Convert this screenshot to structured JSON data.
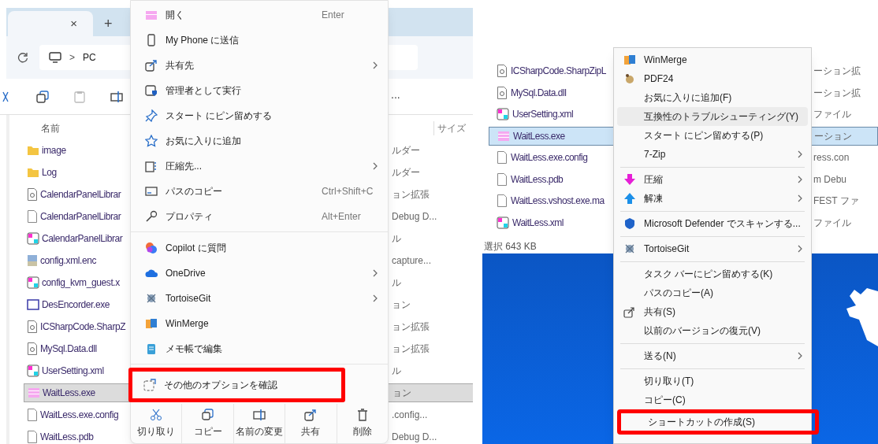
{
  "left_screen": {
    "tab_bar": {
      "close_glyph": "×",
      "new_tab_glyph": "+"
    },
    "address_bar": {
      "separator": ">",
      "location": "PC"
    },
    "toolbar": {
      "more": "..."
    },
    "columns": [
      {
        "label": "名前"
      },
      {
        "label": "サイズ"
      }
    ],
    "files": [
      {
        "kind": "folder",
        "name": "image",
        "type": "ルダー",
        "selected": false
      },
      {
        "kind": "folder",
        "name": "Log",
        "type": "ルダー",
        "selected": false
      },
      {
        "kind": "library",
        "name": "CalendarPanelLibrar",
        "type": "ョン拡張",
        "selected": false
      },
      {
        "kind": "blank",
        "name": "CalendarPanelLibrar",
        "type": "Debug D...",
        "selected": false
      },
      {
        "kind": "markup",
        "name": "CalendarPanelLibrar",
        "type": "ル",
        "selected": false
      },
      {
        "kind": "data",
        "name": "config.xml.enc",
        "type": "capture...",
        "selected": false
      },
      {
        "kind": "markup",
        "name": "config_kvm_guest.x",
        "type": "ル",
        "selected": false
      },
      {
        "kind": "window",
        "name": "DesEncorder.exe",
        "type": "ョン",
        "selected": false
      },
      {
        "kind": "library",
        "name": "ICSharpCode.SharpZ",
        "type": "ョン拡張",
        "selected": false
      },
      {
        "kind": "library",
        "name": "MySql.Data.dll",
        "type": "ョン拡張",
        "selected": false
      },
      {
        "kind": "markup",
        "name": "UserSetting.xml",
        "type": "ル",
        "selected": false
      },
      {
        "kind": "app",
        "name": "WaitLess.exe",
        "type": "ョン",
        "selected": true
      },
      {
        "kind": "blank",
        "name": "WaitLess.exe.config",
        "type": ".config...",
        "selected": false
      },
      {
        "kind": "blank",
        "name": "WaitLess.pdb",
        "type": "Debug D...",
        "selected": false
      }
    ],
    "context_menu": {
      "items": [
        {
          "kind": "item",
          "label": "開く",
          "shortcut": "Enter",
          "submenu": false,
          "highlighted": false
        },
        {
          "kind": "item",
          "label": "My Phone に送信",
          "submenu": false,
          "highlighted": false
        },
        {
          "kind": "item",
          "label": "共有先",
          "submenu": true,
          "highlighted": false
        },
        {
          "kind": "item",
          "label": "管理者として実行",
          "submenu": false,
          "highlighted": false
        },
        {
          "kind": "item",
          "label": "スタート にピン留めする",
          "submenu": false,
          "highlighted": false
        },
        {
          "kind": "item",
          "label": "お気に入りに追加",
          "submenu": false,
          "highlighted": false
        },
        {
          "kind": "item",
          "label": "圧縮先...",
          "submenu": true,
          "highlighted": false
        },
        {
          "kind": "item",
          "label": "パスのコピー",
          "shortcut": "Ctrl+Shift+C",
          "submenu": false,
          "highlighted": false
        },
        {
          "kind": "item",
          "label": "プロパティ",
          "shortcut": "Alt+Enter",
          "submenu": false,
          "highlighted": false
        },
        {
          "kind": "divider"
        },
        {
          "kind": "item",
          "label": "Copilot に質問",
          "submenu": false,
          "highlighted": false
        },
        {
          "kind": "item",
          "label": "OneDrive",
          "submenu": true,
          "highlighted": false
        },
        {
          "kind": "item",
          "label": "TortoiseGit",
          "submenu": true,
          "highlighted": false
        },
        {
          "kind": "item",
          "label": "WinMerge",
          "submenu": false,
          "highlighted": false
        },
        {
          "kind": "item",
          "label": "メモ帳で編集",
          "submenu": false,
          "highlighted": false
        },
        {
          "kind": "divider"
        },
        {
          "kind": "item",
          "label": "その他のオプションを確認",
          "submenu": false,
          "highlighted": true
        }
      ],
      "actions": [
        {
          "label": "切り取り"
        },
        {
          "label": "コピー"
        },
        {
          "label": "名前の変更"
        },
        {
          "label": "共有"
        },
        {
          "label": "削除"
        }
      ]
    }
  },
  "right_screen": {
    "files": [
      {
        "kind": "library",
        "name": "ICSharpCode.SharpZipL",
        "type": "ーション拡",
        "selected": false
      },
      {
        "kind": "library",
        "name": "MySql.Data.dll",
        "type": "ーション拡",
        "selected": false
      },
      {
        "kind": "markup",
        "name": "UserSetting.xml",
        "type": "ファイル",
        "selected": false
      },
      {
        "kind": "app",
        "name": "WaitLess.exe",
        "type": "ーション",
        "selected": true
      },
      {
        "kind": "blank",
        "name": "WaitLess.exe.config",
        "type": "ress.con",
        "selected": false
      },
      {
        "kind": "blank",
        "name": "WaitLess.pdb",
        "type": "m Debu",
        "selected": false
      },
      {
        "kind": "blank",
        "name": "WaitLess.vshost.exe.ma",
        "type": "FEST ファ",
        "selected": false
      },
      {
        "kind": "markup",
        "name": "WaitLess.xml",
        "type": "ファイル",
        "selected": false
      }
    ],
    "status_bar": "選択 643 KB",
    "context_menu": {
      "items": [
        {
          "kind": "item",
          "label": "WinMerge",
          "submenu": false,
          "hovered": false,
          "highlighted": false
        },
        {
          "kind": "item",
          "label": "PDF24",
          "submenu": false,
          "hovered": false,
          "highlighted": false
        },
        {
          "kind": "item",
          "label": "お気に入りに追加(F)",
          "submenu": false,
          "hovered": false,
          "highlighted": false
        },
        {
          "kind": "item",
          "label": "互換性のトラブルシューティング(Y)",
          "submenu": false,
          "hovered": true,
          "highlighted": false
        },
        {
          "kind": "item",
          "label": "スタート にピン留めする(P)",
          "submenu": false,
          "hovered": false,
          "highlighted": false
        },
        {
          "kind": "item",
          "label": "7-Zip",
          "submenu": true,
          "hovered": false,
          "highlighted": false
        },
        {
          "kind": "divider"
        },
        {
          "kind": "item",
          "label": "圧縮",
          "submenu": true,
          "hovered": false,
          "highlighted": false
        },
        {
          "kind": "item",
          "label": "解凍",
          "submenu": true,
          "hovered": false,
          "highlighted": false
        },
        {
          "kind": "divider"
        },
        {
          "kind": "item",
          "label": "Microsoft Defender でスキャンする...",
          "submenu": false,
          "hovered": false,
          "highlighted": false
        },
        {
          "kind": "divider"
        },
        {
          "kind": "item",
          "label": "TortoiseGit",
          "submenu": true,
          "hovered": false,
          "highlighted": false
        },
        {
          "kind": "divider"
        },
        {
          "kind": "item",
          "label": "タスク バーにピン留めする(K)",
          "submenu": false,
          "hovered": false,
          "highlighted": false
        },
        {
          "kind": "item",
          "label": "パスのコピー(A)",
          "submenu": false,
          "hovered": false,
          "highlighted": false
        },
        {
          "kind": "item",
          "label": "共有(S)",
          "submenu": false,
          "hovered": false,
          "highlighted": false
        },
        {
          "kind": "item",
          "label": "以前のバージョンの復元(V)",
          "submenu": false,
          "hovered": false,
          "highlighted": false
        },
        {
          "kind": "divider"
        },
        {
          "kind": "item",
          "label": "送る(N)",
          "submenu": true,
          "hovered": false,
          "highlighted": false
        },
        {
          "kind": "divider"
        },
        {
          "kind": "item",
          "label": "切り取り(T)",
          "submenu": false,
          "hovered": false,
          "highlighted": false
        },
        {
          "kind": "item",
          "label": "コピー(C)",
          "submenu": false,
          "hovered": false,
          "highlighted": false
        },
        {
          "kind": "item",
          "label": "ショートカットの作成(S)",
          "submenu": false,
          "hovered": false,
          "highlighted": true
        }
      ]
    }
  }
}
